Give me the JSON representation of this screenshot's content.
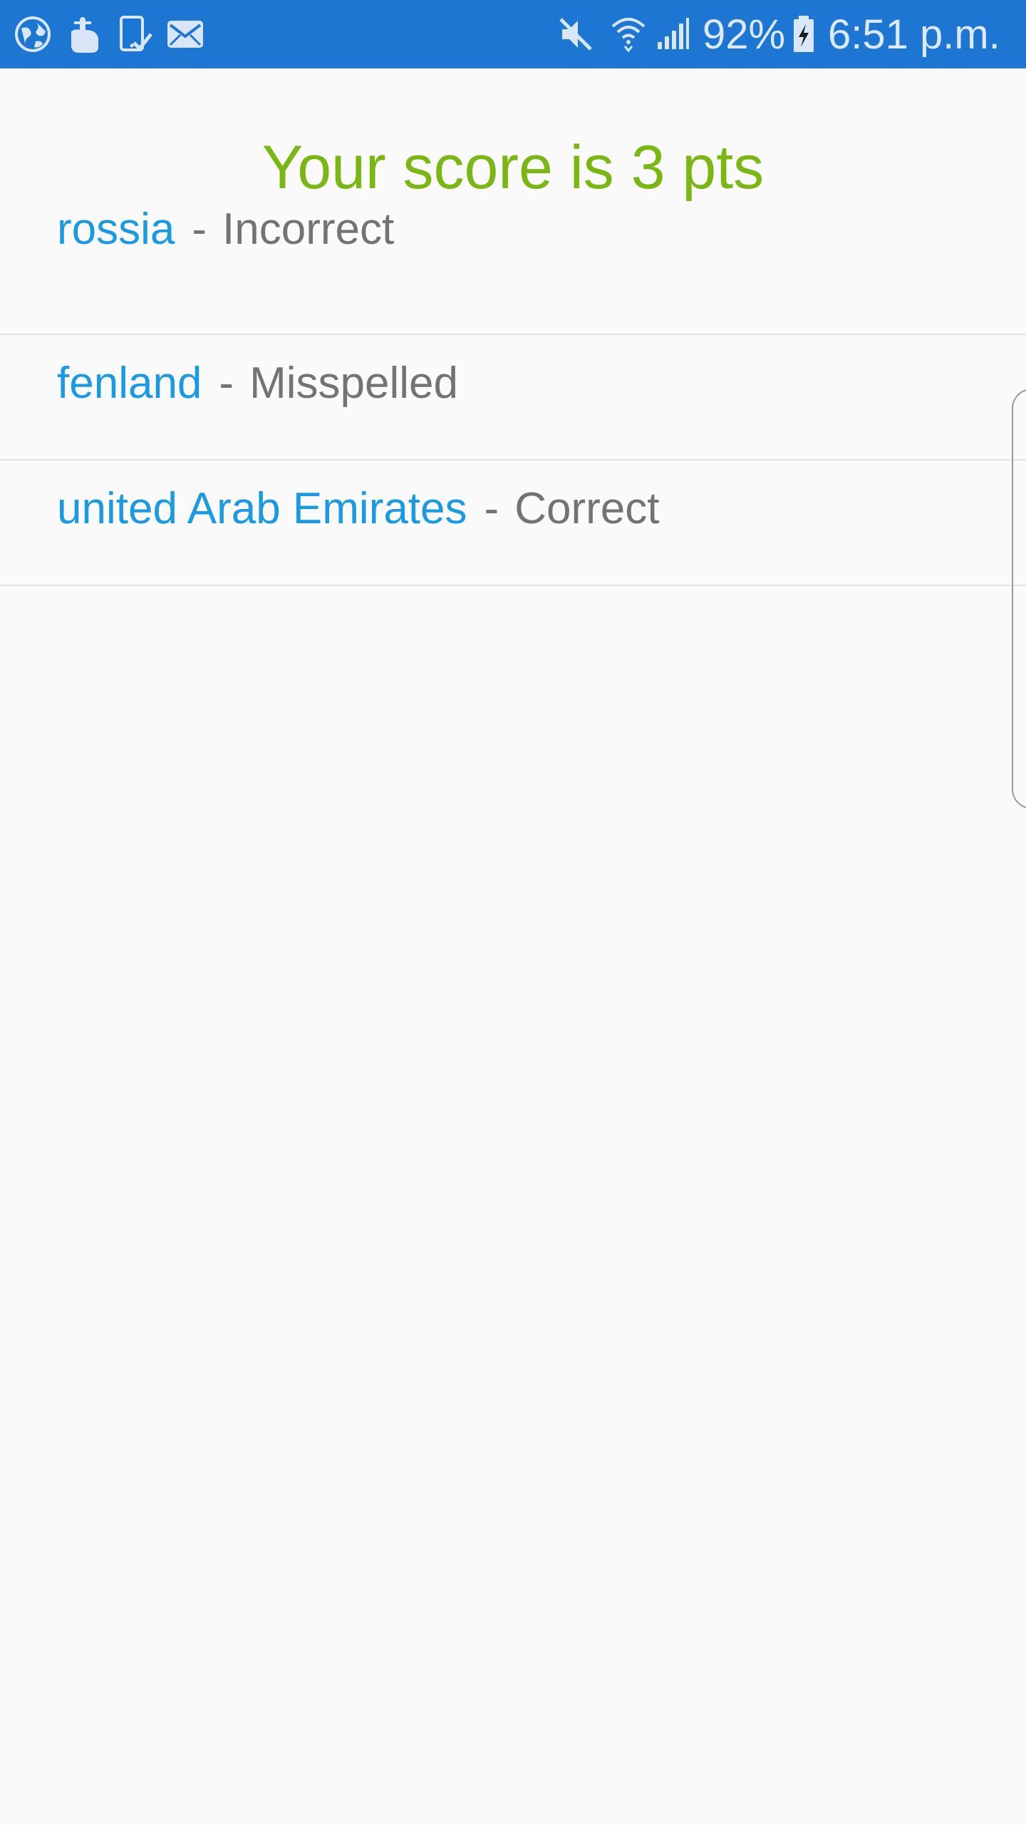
{
  "status_bar": {
    "icons_left": [
      "globe-icon",
      "touch-hand-icon",
      "tablet-check-icon",
      "mail-icon"
    ],
    "icons_right": [
      "mute-icon",
      "wifi-icon",
      "signal-icon",
      "battery-charging-icon"
    ],
    "battery_text": "92%",
    "time": "6:51 p.m.",
    "background_color": "#1c76d2"
  },
  "score": {
    "title": "Your score is 3 pts",
    "color": "#7ab712"
  },
  "results": [
    {
      "answer": "rossia",
      "separator": "-",
      "verdict": "Incorrect"
    },
    {
      "answer": "fenland",
      "separator": "-",
      "verdict": "Misspelled"
    },
    {
      "answer": "united Arab Emirates",
      "separator": "-",
      "verdict": "Correct"
    }
  ],
  "colors": {
    "answer": "#1a9ae3",
    "verdict": "#737373",
    "background": "#fafafa"
  }
}
